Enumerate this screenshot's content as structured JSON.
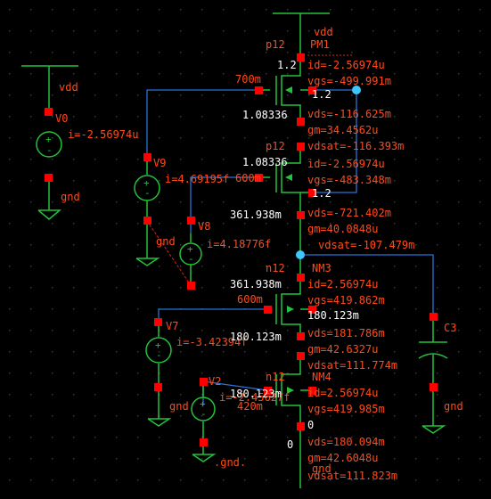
{
  "palette": {
    "background": "#000000",
    "wire": "#2a73d8",
    "net_highlight": "#3ec7ff",
    "device": "#22c33a",
    "pin": "#ff0000",
    "annotation": "#ff4a1a",
    "node_text": "#ffffff",
    "grid_dot": "#3a3a3a"
  },
  "sources": {
    "V0": {
      "name": "V0",
      "current": "i=-2.56974u",
      "top_net": "vdd",
      "bottom_net": "gnd"
    },
    "V9": {
      "name": "V9",
      "current": "i=4.69195f",
      "bottom_net": "gnd"
    },
    "V8": {
      "name": "V8",
      "current": "i=4.18776f"
    },
    "V7": {
      "name": "V7",
      "current": "i=-3.42394f"
    },
    "V2": {
      "name": "V2",
      "current": "i=-2.45627f"
    }
  },
  "capacitor": {
    "name": "C3",
    "bottom_net": "gnd"
  },
  "transistors": {
    "PM1": {
      "name": "PM1",
      "model": "p12",
      "gate_node": "700m",
      "top_node": "vdd",
      "vbulk": "1.2",
      "vsource": "1.2",
      "vdrain": "1.08336",
      "params": [
        "id=-2.56974u",
        "vgs=-499.991m",
        "vds=-116.625m",
        "gm=34.4562u",
        "vdsat=-116.393m"
      ]
    },
    "PM2": {
      "model": "p12",
      "gate_node": "600m",
      "vsource": "1.08336",
      "vbulk": "1.2",
      "vdrain": "361.938m",
      "params": [
        "id=-2.56974u",
        "vgs=-483.348m",
        "vds=-721.402m",
        "gm=40.0848u",
        "vdsat=-107.479m"
      ]
    },
    "NM3": {
      "name": "NM3",
      "model": "n12",
      "gate_node": "600m",
      "vdrain": "361.938m",
      "vbulk": "180.123m",
      "vsource": "180.123m",
      "params": [
        "id=2.56974u",
        "vgs=419.862m",
        "vds=181.786m",
        "gm=42.6327u",
        "vdsat=111.774m"
      ]
    },
    "NM4": {
      "name": "NM4",
      "model": "n12",
      "gate_node": "420m",
      "vdrain": "180.123m",
      "vbulk": "0",
      "vsource": "0",
      "params": [
        "id=2.56974u",
        "vgs=419.985m",
        "vds=180.094m",
        "gm=42.6048u",
        "vdsat=111.823m"
      ]
    }
  },
  "net_labels": {
    "gnd_dotted": ".gnd.",
    "gnd": "gnd",
    "gnd_bottom": "gnd"
  }
}
